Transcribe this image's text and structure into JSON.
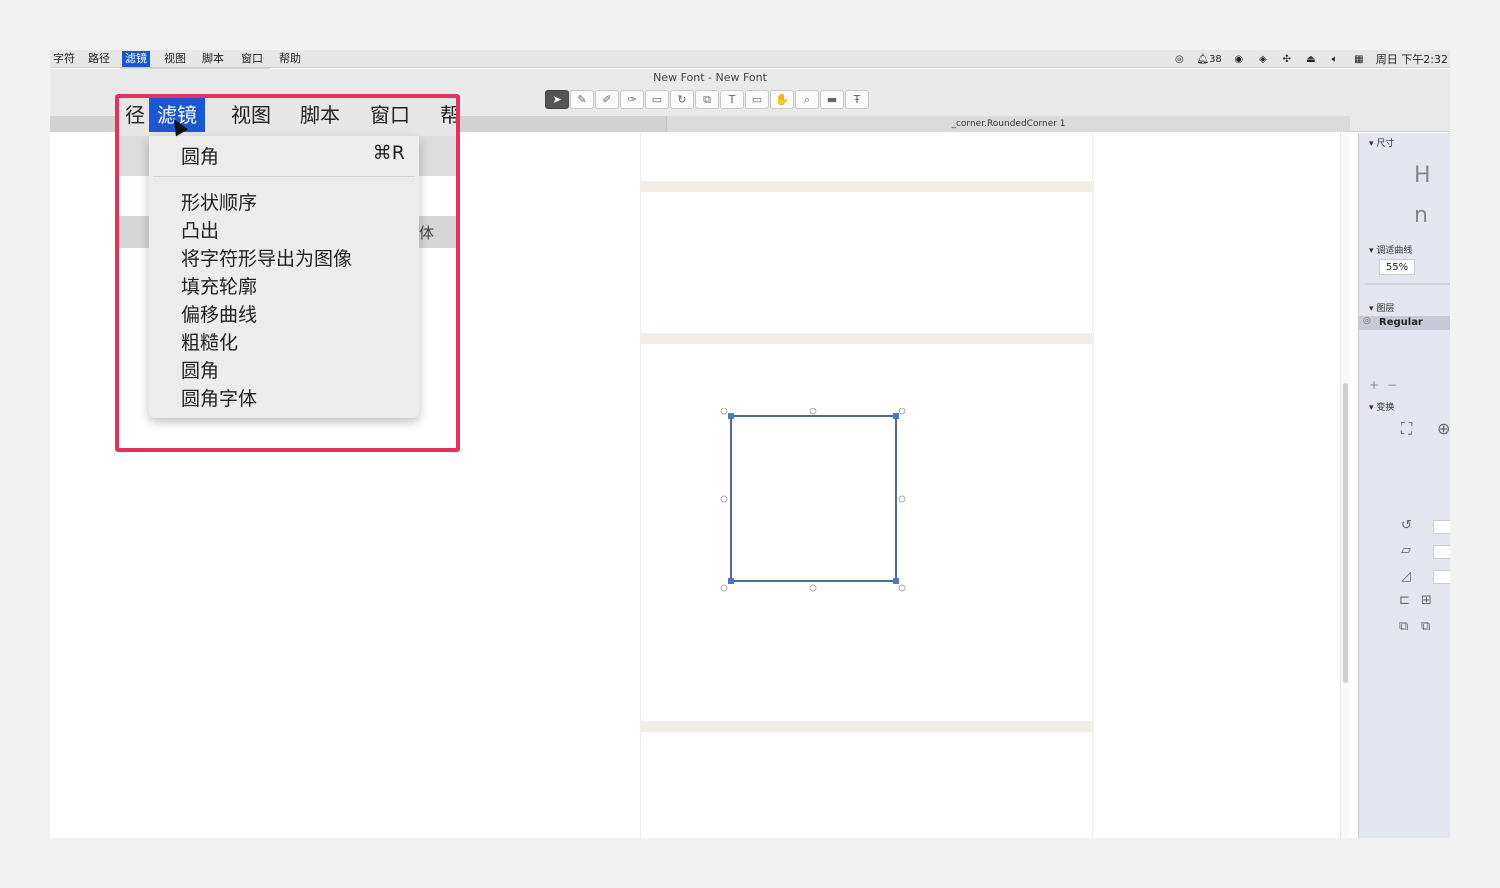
{
  "menubar": {
    "items": [
      "字符",
      "路径",
      "滤镜",
      "视图",
      "脚本",
      "窗口",
      "帮助"
    ],
    "active_index": 2,
    "status": {
      "notify_count": "38",
      "clock": "周日 下午2:32"
    }
  },
  "small_menu": {
    "label": "圆角",
    "shortcut": "⌘R"
  },
  "window": {
    "title": "New Font - New Font"
  },
  "toolbar": {
    "tools": [
      "select-tool-icon",
      "pen-tool-icon",
      "pencil-tool-icon",
      "brush-tool-icon",
      "rectangle-tool-icon",
      "rotate-tool-icon",
      "scale-tool-icon",
      "text-tool-icon",
      "annotation-tool-icon",
      "hand-tool-icon",
      "zoom-tool-icon",
      "measure-tool-icon",
      "text-preview-tool-icon"
    ],
    "glyphs": [
      "➤",
      "✎",
      "✐",
      "✑",
      "▭",
      "↻",
      "⧉",
      "T",
      "▭",
      "✋",
      "⌕",
      "▬",
      "Ŧ"
    ]
  },
  "tab": {
    "label": "_corner.RoundedCorner 1"
  },
  "panel": {
    "size_header": "尺寸",
    "curve_header": "调适曲线",
    "curve_value": "55%",
    "layers_header": "图层",
    "layer_name": "Regular",
    "transform_header": "变换",
    "layers_add": "+",
    "layers_remove": "−"
  },
  "zoom": {
    "bar_items": [
      "径",
      "滤镜",
      "视图",
      "脚本",
      "窗口",
      "帮"
    ],
    "active_index": 1,
    "gray_text": "体",
    "menu": {
      "first": {
        "label": "圆角",
        "shortcut": "⌘R"
      },
      "items": [
        "形状顺序",
        "凸出",
        "将字符形导出为图像",
        "填充轮廓",
        "偏移曲线",
        "粗糙化",
        "圆角",
        "圆角字体"
      ]
    }
  }
}
